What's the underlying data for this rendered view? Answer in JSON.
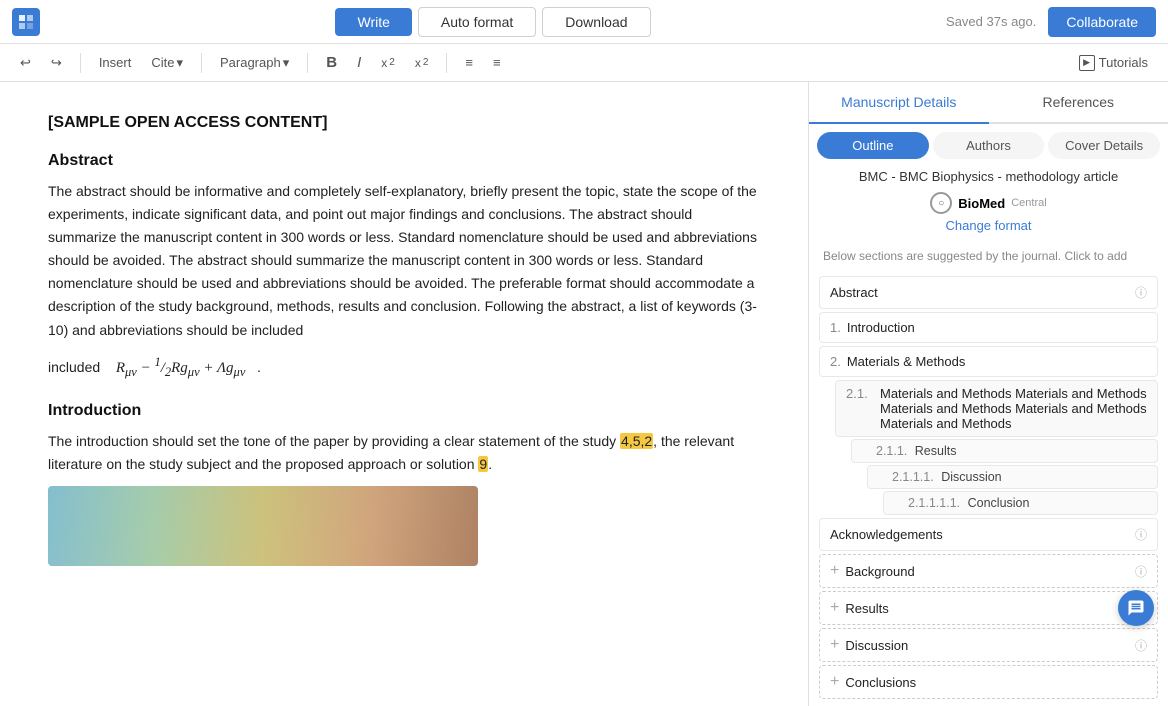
{
  "topbar": {
    "logo": "A",
    "write_label": "Write",
    "autoformat_label": "Auto format",
    "download_label": "Download",
    "saved_text": "Saved 37s ago.",
    "collaborate_label": "Collaborate"
  },
  "toolbar": {
    "undo_label": "↩",
    "redo_label": "↪",
    "insert_label": "Insert",
    "cite_label": "Cite",
    "paragraph_label": "Paragraph",
    "bold_label": "B",
    "italic_label": "I",
    "superscript_label": "x²",
    "subscript_label": "x₂",
    "align_label": "≡",
    "indent_label": "≡",
    "tutorials_label": "Tutorials"
  },
  "editor": {
    "title": "[SAMPLE OPEN ACCESS CONTENT]",
    "abstract_heading": "Abstract",
    "abstract_body": "The abstract should be informative and completely self-explanatory, briefly present the topic, state the scope of the experiments, indicate significant data, and point out major findings and conclusions. The abstract should summarize the manuscript content in 300 words or less. Standard nomenclature should be used and abbreviations should be avoided.  The abstract should summarize the manuscript content in 300 words or less. Standard nomenclature should be used and abbreviations should be avoided. The preferable format should accommodate a description of the study background, methods, results and conclusion. Following the abstract, a list of keywords (3-10) and abbreviations should be included",
    "formula_text": "R_μν − ½Rg_μν + Λg_μν",
    "intro_heading": "Introduction",
    "intro_body_before": "The introduction should set the tone of the paper by providing a clear statement of the study ",
    "intro_highlight": "4,5,2",
    "intro_body_middle": ", the relevant literature on the study subject and the proposed approach or solution ",
    "intro_highlight2": "9",
    "intro_body_after": "."
  },
  "right_panel": {
    "tab_manuscript": "Manuscript Details",
    "tab_references": "References",
    "sub_tab_outline": "Outline",
    "sub_tab_authors": "Authors",
    "sub_tab_cover": "Cover Details",
    "journal_label": "BMC - BMC Biophysics - methodology article",
    "biomed_name": "BioMed",
    "biomed_central": "Central",
    "change_format": "Change format",
    "section_hint": "Below sections are suggested by the journal. Click to add",
    "outline_items": [
      {
        "label": "Abstract",
        "type": "solid",
        "has_info": true
      },
      {
        "num": "1.",
        "label": "Introduction",
        "type": "solid",
        "has_info": false
      }
    ],
    "outline_section2": {
      "num": "2.",
      "label": "Materials & Methods",
      "sub_num": "2.1.",
      "sub_label": "Materials and Methods Materials and Methods Materials and Methods Materials and Methods Materials and Methods",
      "sub_sub_num": "2.1.1.",
      "sub_sub_label": "Results",
      "nested1_num": "2.1.1.1.",
      "nested1_label": "Discussion",
      "nested2_num": "2.1.1.1.1.",
      "nested2_label": "Conclusion"
    },
    "dashed_items": [
      {
        "label": "Acknowledgements",
        "has_info": true
      },
      {
        "label": "Background",
        "has_plus": true,
        "has_info": true
      },
      {
        "label": "Results",
        "has_plus": true,
        "has_info": true
      },
      {
        "label": "Discussion",
        "has_plus": true,
        "has_info": true
      },
      {
        "label": "Conclusions",
        "has_plus": true,
        "has_info": false
      }
    ]
  }
}
